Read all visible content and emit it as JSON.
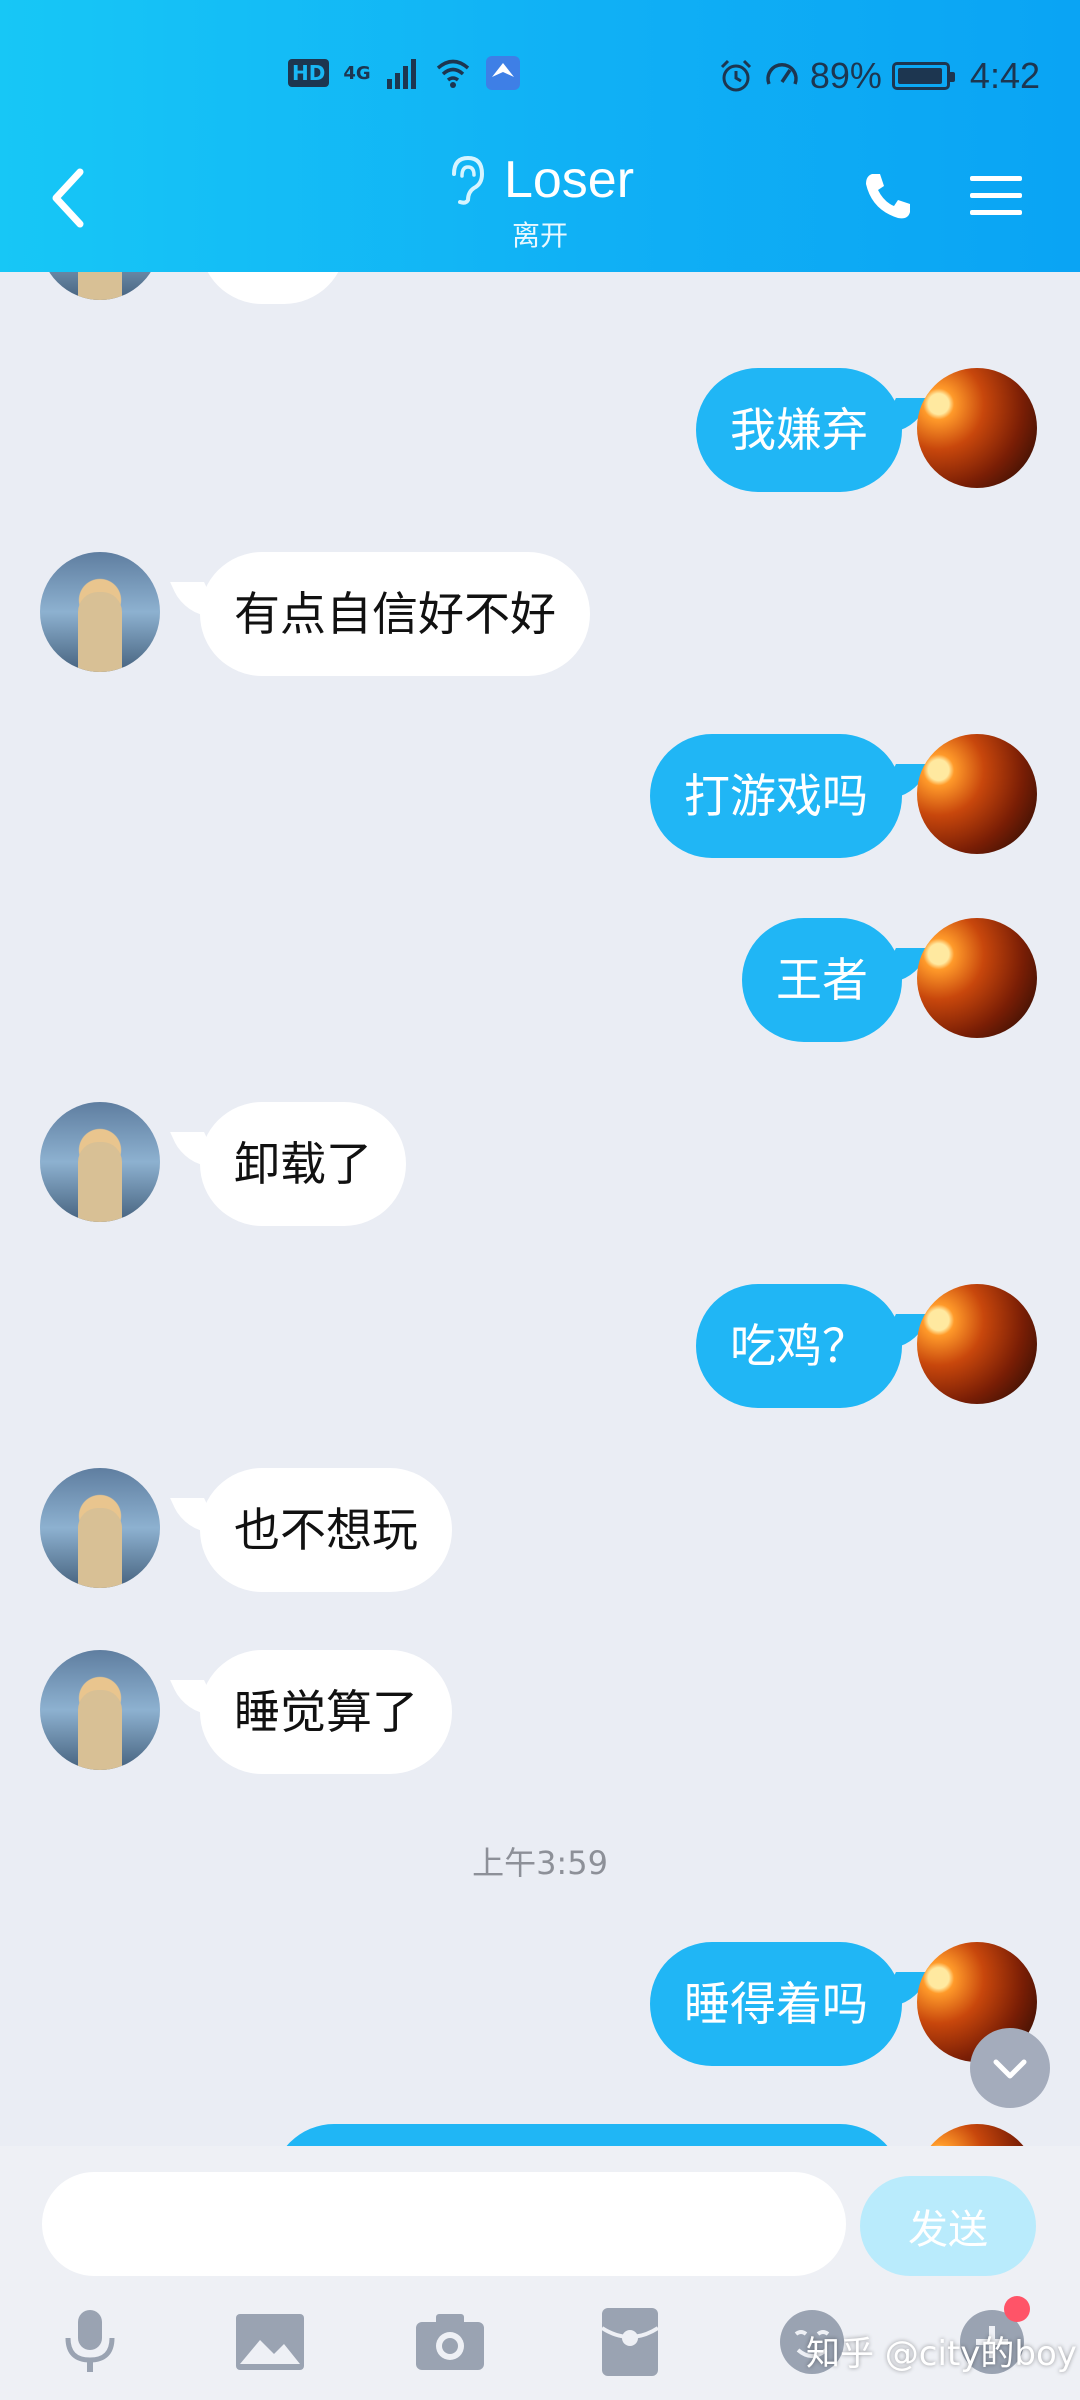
{
  "status_bar": {
    "hd": "HD",
    "network": "4G",
    "battery_percent": "89%",
    "time": "4:42"
  },
  "header": {
    "contact_name": "Loser",
    "presence": "离开"
  },
  "messages": [
    {
      "side": "in",
      "text": ""
    },
    {
      "side": "out",
      "text": "我嫌弃"
    },
    {
      "side": "in",
      "text": "有点自信好不好"
    },
    {
      "side": "out",
      "text": "打游戏吗"
    },
    {
      "side": "out",
      "text": "王者"
    },
    {
      "side": "in",
      "text": "卸载了"
    },
    {
      "side": "out",
      "text": "吃鸡？"
    },
    {
      "side": "in",
      "text": "也不想玩"
    },
    {
      "side": "in",
      "text": "睡觉算了"
    },
    {
      "side": "out",
      "text": "睡得着吗"
    }
  ],
  "timestamp": "上午3:59",
  "input": {
    "value": "",
    "send_label": "发送"
  },
  "toolbar": [
    "microphone-icon",
    "image-icon",
    "camera-icon",
    "red-packet-icon",
    "emoji-icon",
    "plus-icon"
  ],
  "watermark": "知乎 @city的boy",
  "colors": {
    "header_start": "#17c7f6",
    "header_end": "#0aa4f4",
    "outgoing_bubble": "#20b6f5",
    "incoming_bubble": "#ffffff",
    "chat_background": "#eaedf4",
    "send_button": "#b9ebfc",
    "notification_dot": "#ff5468"
  }
}
